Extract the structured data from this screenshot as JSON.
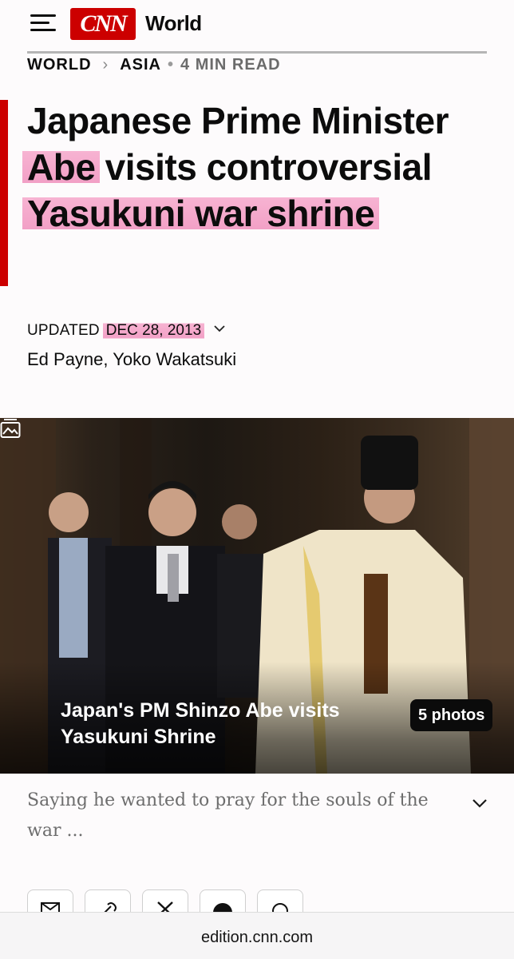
{
  "header": {
    "logo_text": "CNN",
    "section_label": "World"
  },
  "breadcrumb": {
    "items": [
      "WORLD",
      "ASIA"
    ],
    "read_time": "4 MIN READ"
  },
  "article": {
    "headline_parts": [
      "Japanese Prime Minister ",
      "Abe",
      " visits controversial ",
      "Yasukuni",
      " war shrine"
    ],
    "highlighted": [
      "Abe",
      "Yasukuni",
      "war shrine"
    ],
    "updated_label": "UPDATED",
    "date": "DEC 28, 2013",
    "authors": [
      "Ed Payne",
      "Yoko Wakatsuki"
    ]
  },
  "gallery": {
    "caption": "Japan's PM Shinzo Abe visits Yasukuni Shrine",
    "count_label": "5 photos"
  },
  "description": {
    "text": "Saying he wanted to pray for the souls of the war ..."
  },
  "share": {
    "icons": [
      "email-icon",
      "link-icon",
      "x-icon",
      "facebook-icon",
      "whatsapp-icon"
    ]
  },
  "browser": {
    "url": "edition.cnn.com"
  },
  "colors": {
    "brand_red": "#cc0000",
    "highlight_pink": "#f2a0c6"
  }
}
